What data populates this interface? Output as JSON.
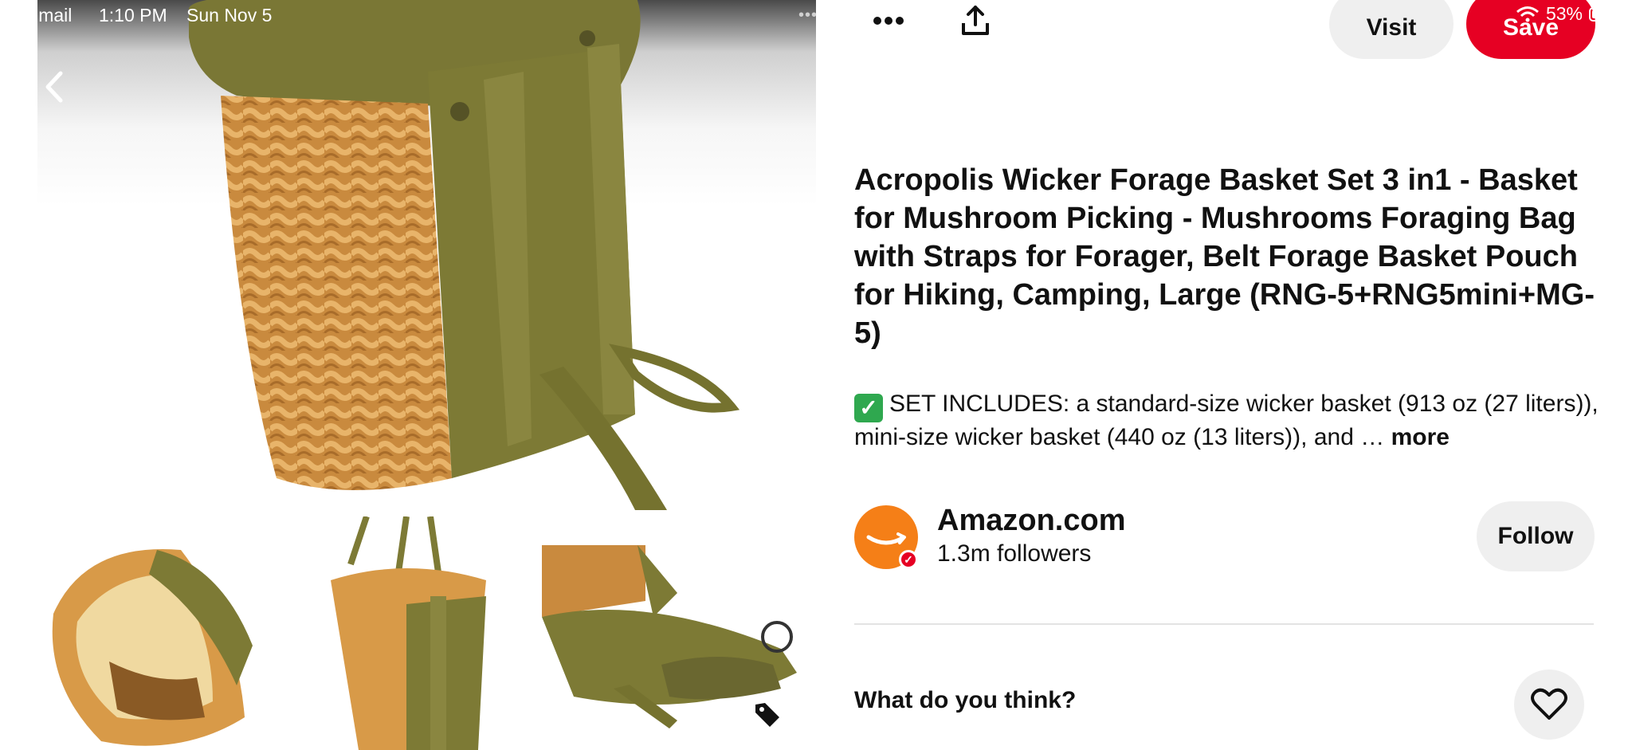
{
  "status_bar": {
    "back_app": "Gmail",
    "time": "1:10 PM",
    "date": "Sun Nov 5",
    "battery": "53%"
  },
  "toolbar": {
    "more_icon": "ellipsis-icon",
    "share_icon": "share-upload-icon",
    "visit_label": "Visit",
    "save_label": "Save"
  },
  "pin": {
    "title": "Acropolis Wicker Forage Basket Set 3 in1 - Basket for Mushroom Picking - Mushrooms Foraging Bag with Straps for Forager, Belt Forage Basket Pouch for Hiking, Camping, Large (RNG-5+RNG5mini+MG-5)",
    "description": "SET INCLUDES: a standard-size wicker basket (913 oz (27 liters)), mini-size wicker basket (440 oz (13 liters)), and …",
    "more_label": "more"
  },
  "creator": {
    "name": "Amazon.com",
    "followers": "1.3m followers",
    "follow_label": "Follow"
  },
  "feedback": {
    "question": "What do you think?"
  },
  "colors": {
    "save": "#e60023",
    "amazon": "#f57f17",
    "wicker": "#d99a48",
    "olive": "#7d7a35",
    "button_bg": "#efefef"
  }
}
